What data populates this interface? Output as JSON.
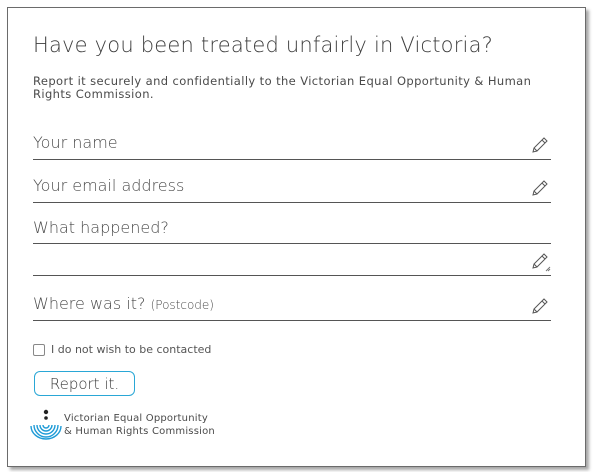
{
  "form": {
    "title": "Have you been treated unfairly in Victoria?",
    "subtitle": "Report it securely and confidentially to the Victorian Equal Opportunity & Human Rights Commission.",
    "fields": {
      "name": {
        "placeholder": "Your name",
        "icon": "pencil-icon"
      },
      "email": {
        "placeholder": "Your email address",
        "icon": "pencil-icon"
      },
      "what_happened": {
        "placeholder": "What happened?",
        "icon": "pencil-resize-icon"
      },
      "postcode": {
        "placeholder": "Where was it?",
        "placeholder_small": "(Postcode)",
        "icon": "pencil-icon"
      }
    },
    "checkbox": {
      "label": "I do not wish to be contacted",
      "checked": false
    },
    "submit_label": "Report it.",
    "accent_color": "#2aa7d6"
  },
  "logo": {
    "line1": "Victorian Equal Opportunity",
    "line2": "& Human Rights Commission",
    "color": "#1e9bd7"
  }
}
